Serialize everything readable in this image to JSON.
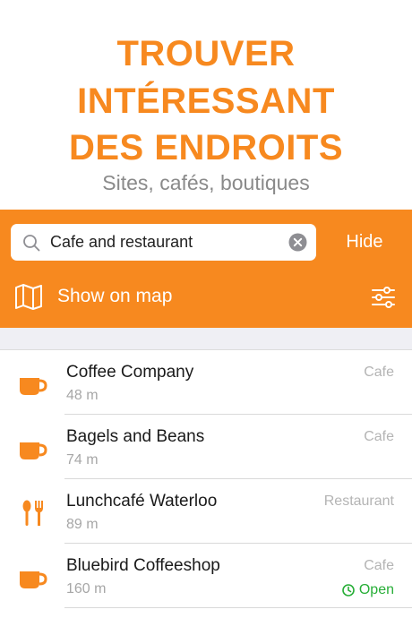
{
  "hero": {
    "headline_line1": "TROUVER",
    "headline_line2": "INTÉRESSANT",
    "headline_line3": "DES ENDROITS",
    "subtitle": "Sites, cafés, boutiques"
  },
  "search": {
    "value": "Cafe and restaurant",
    "hide_label": "Hide",
    "map_label": "Show on map"
  },
  "colors": {
    "accent": "#f7891f",
    "open": "#27ae37"
  },
  "places": [
    {
      "name": "Coffee Company",
      "distance": "48 m",
      "category": "Cafe",
      "icon": "coffee-cup-icon",
      "status": ""
    },
    {
      "name": "Bagels and Beans",
      "distance": "74 m",
      "category": "Cafe",
      "icon": "coffee-cup-icon",
      "status": ""
    },
    {
      "name": "Lunchcafé Waterloo",
      "distance": "89 m",
      "category": "Restaurant",
      "icon": "cutlery-icon",
      "status": ""
    },
    {
      "name": "Bluebird Coffeeshop",
      "distance": "160 m",
      "category": "Cafe",
      "icon": "coffee-cup-icon",
      "status": "Open"
    }
  ]
}
